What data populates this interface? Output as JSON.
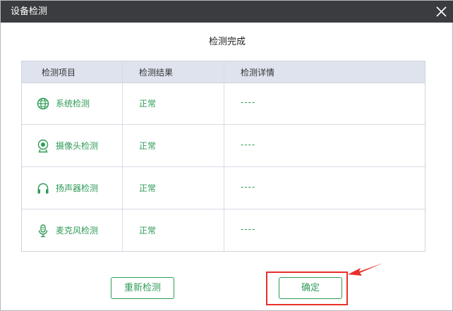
{
  "window": {
    "title": "设备检测"
  },
  "heading": "检测完成",
  "table": {
    "headers": [
      "检测项目",
      "检测结果",
      "检测详情"
    ],
    "rows": [
      {
        "icon": "globe-icon",
        "name": "系统检测",
        "result": "正常",
        "detail": "----"
      },
      {
        "icon": "webcam-icon",
        "name": "摄像头检测",
        "result": "正常",
        "detail": "----"
      },
      {
        "icon": "headphones-icon",
        "name": "扬声器检测",
        "result": "正常",
        "detail": "----"
      },
      {
        "icon": "microphone-icon",
        "name": "麦克风检测",
        "result": "正常",
        "detail": "----"
      }
    ]
  },
  "buttons": {
    "retest_label": "重新检测",
    "confirm_label": "确定"
  },
  "colors": {
    "accent": "#2e9b57",
    "titlebar": "#3b3c40",
    "header_bg": "#dfe3ee",
    "annotation": "#e8302a"
  }
}
